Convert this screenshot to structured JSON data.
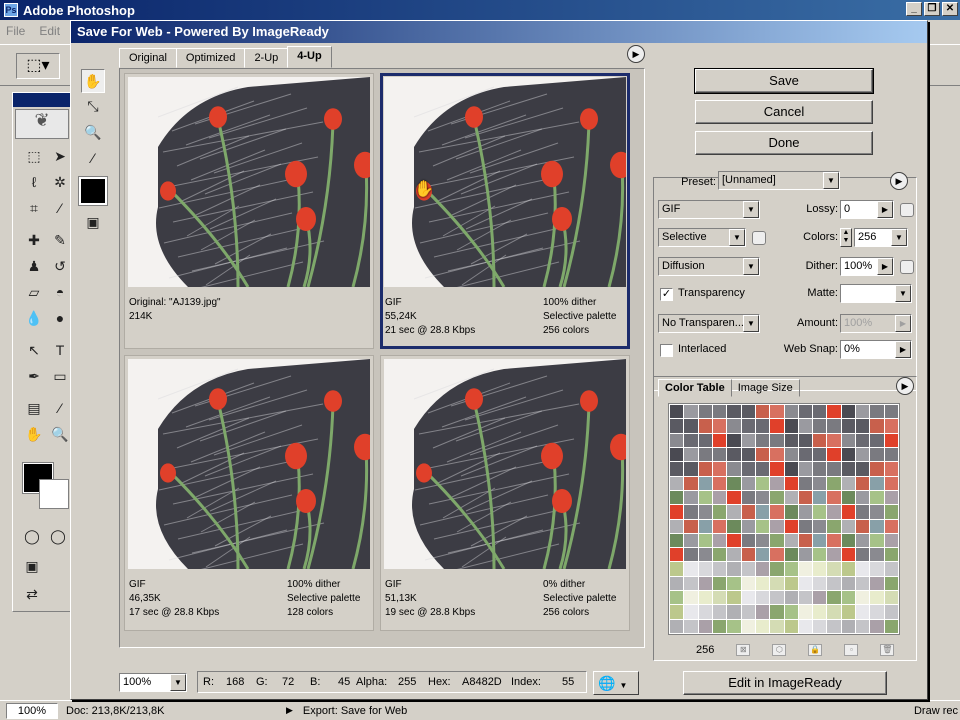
{
  "app": {
    "title": "Adobe Photoshop",
    "menu": [
      "File",
      "Edit"
    ],
    "window_buttons": [
      "_",
      "❐",
      "✕"
    ]
  },
  "status": {
    "zoom": "100%",
    "doc": "Doc: 213,8K/213,8K",
    "export": "Export: Save for Web",
    "draw": "Draw rec"
  },
  "dialog": {
    "title": "Save For Web - Powered By ImageReady",
    "tabs": [
      "Original",
      "Optimized",
      "2-Up",
      "4-Up"
    ],
    "active_tab": "4-Up",
    "panes": [
      {
        "l1": "Original: \"AJ139.jpg\"",
        "l2": "214K",
        "l3": "",
        "r1": "",
        "r2": "",
        "r3": ""
      },
      {
        "l1": "GIF",
        "l2": "55,24K",
        "l3": "21 sec @ 28.8 Kbps",
        "r1": "100% dither",
        "r2": "Selective palette",
        "r3": "256 colors"
      },
      {
        "l1": "GIF",
        "l2": "46,35K",
        "l3": "17 sec @ 28.8 Kbps",
        "r1": "100% dither",
        "r2": "Selective palette",
        "r3": "128 colors"
      },
      {
        "l1": "GIF",
        "l2": "51,13K",
        "l3": "19 sec @ 28.8 Kbps",
        "r1": "0% dither",
        "r2": "Selective palette",
        "r3": "256 colors"
      }
    ],
    "buttons": {
      "save": "Save",
      "cancel": "Cancel",
      "done": "Done",
      "edit_imageready": "Edit in ImageReady"
    },
    "settings": {
      "preset_label": "Preset:",
      "preset_value": "[Unnamed]",
      "format": "GIF",
      "reduction": "Selective",
      "dither_algo": "Diffusion",
      "lossy_label": "Lossy:",
      "lossy_value": "0",
      "colors_label": "Colors:",
      "colors_value": "256",
      "dither_label": "Dither:",
      "dither_value": "100%",
      "transparency_label": "Transparency",
      "transparency_checked": true,
      "matte_label": "Matte:",
      "matte_value": "",
      "trans_dither": "No Transparen...",
      "amount_label": "Amount:",
      "amount_value": "100%",
      "interlaced_label": "Interlaced",
      "interlaced_checked": false,
      "websnap_label": "Web Snap:",
      "websnap_value": "0%"
    },
    "color_table": {
      "tabs": [
        "Color Table",
        "Image Size"
      ],
      "count": "256"
    },
    "readout": {
      "zoom": "100%",
      "r_label": "R:",
      "r": "168",
      "g_label": "G:",
      "g": "72",
      "b_label": "B:",
      "b": "45",
      "alpha_label": "Alpha:",
      "alpha": "255",
      "hex_label": "Hex:",
      "hex": "A8482D",
      "index_label": "Index:",
      "index": "55"
    }
  },
  "colors": {
    "accent": "#0a246a",
    "selected_border": "#1c2c6c",
    "flower": "#e0402a"
  }
}
